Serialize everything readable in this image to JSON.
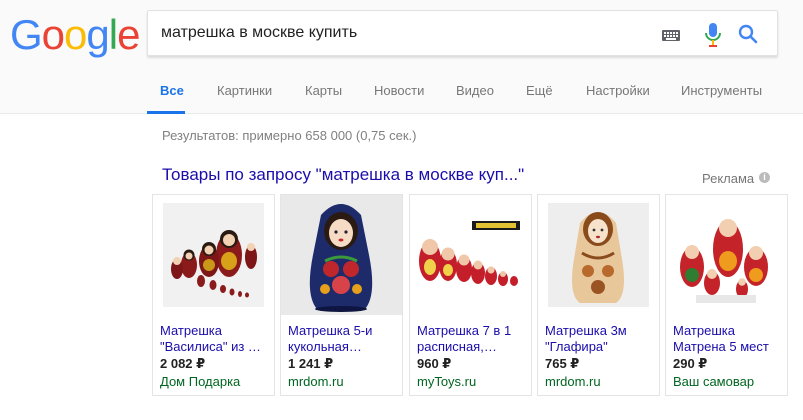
{
  "logo": {
    "letters": [
      "G",
      "o",
      "o",
      "g",
      "l",
      "e"
    ],
    "colors": [
      "#4285F4",
      "#EA4335",
      "#FBBC05",
      "#4285F4",
      "#34A853",
      "#EA4335"
    ]
  },
  "search": {
    "query": "матрешка в москве купить",
    "icons": [
      "keyboard-icon",
      "microphone-icon",
      "search-icon"
    ]
  },
  "tabs": [
    {
      "label": "Все",
      "active": true
    },
    {
      "label": "Картинки"
    },
    {
      "label": "Карты"
    },
    {
      "label": "Новости"
    },
    {
      "label": "Видео"
    },
    {
      "label": "Ещё"
    },
    {
      "label": "Настройки"
    },
    {
      "label": "Инструменты"
    }
  ],
  "results_count": "Результатов: примерно 658 000 (0,75 сек.)",
  "shopping": {
    "title": "Товары по запросу \"матрешка в москве куп...\"",
    "ad_label": "Реклама",
    "info_icon_glyph": "i",
    "products": [
      {
        "title": "Матрешка \"Василиса\" из …",
        "price": "2 082 ₽",
        "store": "Дом Подарка"
      },
      {
        "title": "Матрешка 5-и кукольная…",
        "price": "1 241 ₽",
        "store": "mrdom.ru"
      },
      {
        "title": "Матрешка 7 в 1 расписная,…",
        "price": "960 ₽",
        "store": "myToys.ru"
      },
      {
        "title": "Матрешка 3м \"Глафира\"",
        "price": "765 ₽",
        "store": "mrdom.ru"
      },
      {
        "title": "Матрешка Матрена 5 мест",
        "price": "290 ₽",
        "store": "Ваш самовар"
      }
    ]
  }
}
